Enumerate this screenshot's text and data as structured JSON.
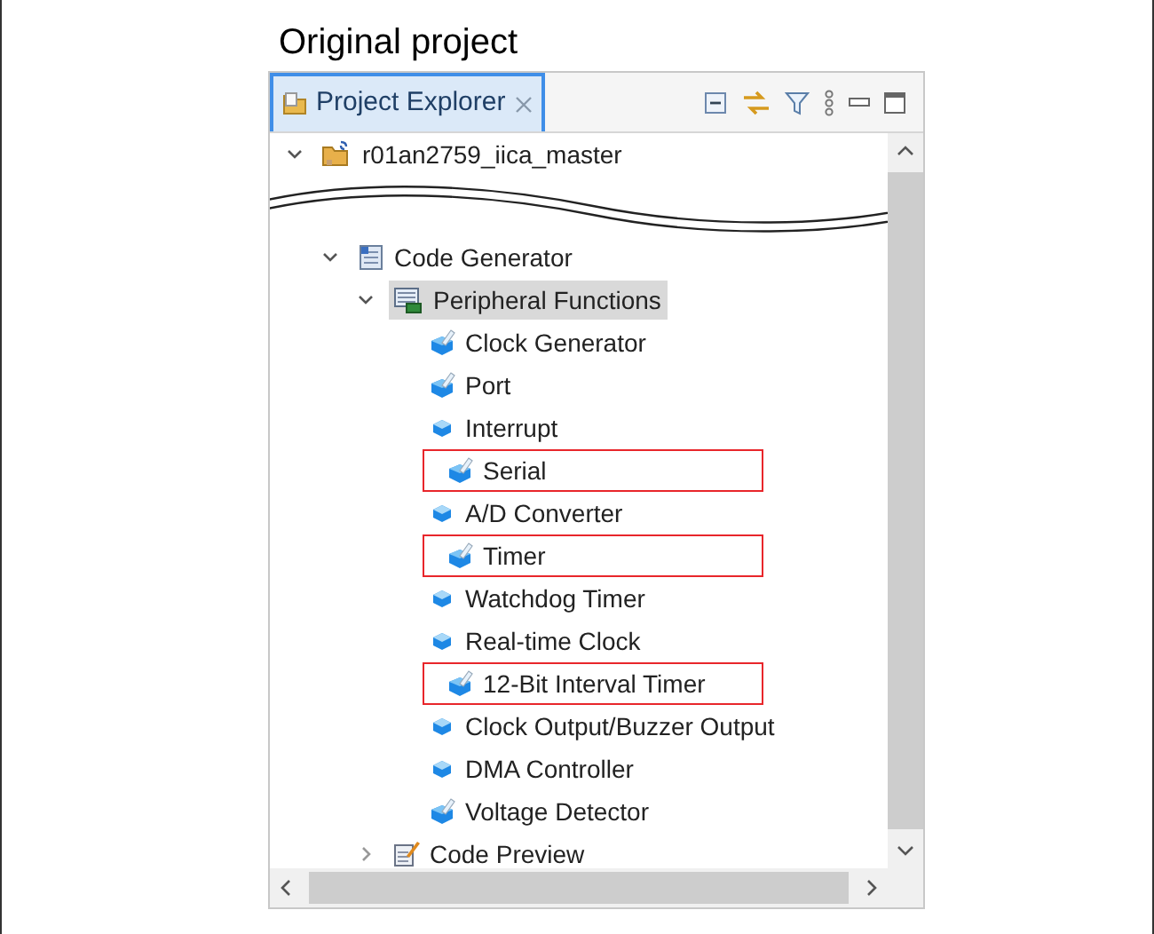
{
  "title": "Original project",
  "panel": {
    "tab": {
      "label": "Project Explorer",
      "selected": true
    },
    "tree": [
      {
        "label": "r01an2759_iica_master",
        "kind": "project",
        "expanded": true,
        "selected": false,
        "break_after": true,
        "children": [
          {
            "label": "Code Generator",
            "kind": "generator",
            "expanded": true,
            "selected": false,
            "children": [
              {
                "label": "Peripheral Functions",
                "kind": "folder",
                "expanded": true,
                "selected": true,
                "children": [
                  {
                    "label": "Clock Generator",
                    "kind": "component",
                    "configured": true,
                    "highlighted": false,
                    "selected": false
                  },
                  {
                    "label": "Port",
                    "kind": "component",
                    "configured": true,
                    "highlighted": false,
                    "selected": false
                  },
                  {
                    "label": "Interrupt",
                    "kind": "component",
                    "configured": false,
                    "highlighted": false,
                    "selected": false
                  },
                  {
                    "label": "Serial",
                    "kind": "component",
                    "configured": true,
                    "highlighted": true,
                    "selected": false
                  },
                  {
                    "label": "A/D Converter",
                    "kind": "component",
                    "configured": false,
                    "highlighted": false,
                    "selected": false
                  },
                  {
                    "label": "Timer",
                    "kind": "component",
                    "configured": true,
                    "highlighted": true,
                    "selected": false
                  },
                  {
                    "label": "Watchdog Timer",
                    "kind": "component",
                    "configured": false,
                    "highlighted": false,
                    "selected": false
                  },
                  {
                    "label": "Real-time Clock",
                    "kind": "component",
                    "configured": false,
                    "highlighted": false,
                    "selected": false
                  },
                  {
                    "label": "12-Bit Interval Timer",
                    "kind": "component",
                    "configured": true,
                    "highlighted": true,
                    "selected": false
                  },
                  {
                    "label": "Clock Output/Buzzer Output",
                    "kind": "component",
                    "configured": false,
                    "highlighted": false,
                    "selected": false
                  },
                  {
                    "label": "DMA Controller",
                    "kind": "component",
                    "configured": false,
                    "highlighted": false,
                    "selected": false
                  },
                  {
                    "label": "Voltage Detector",
                    "kind": "component",
                    "configured": true,
                    "highlighted": false,
                    "selected": false
                  }
                ]
              },
              {
                "label": "Code Preview",
                "kind": "preview",
                "expanded": false,
                "selected": false
              }
            ]
          }
        ]
      }
    ]
  }
}
